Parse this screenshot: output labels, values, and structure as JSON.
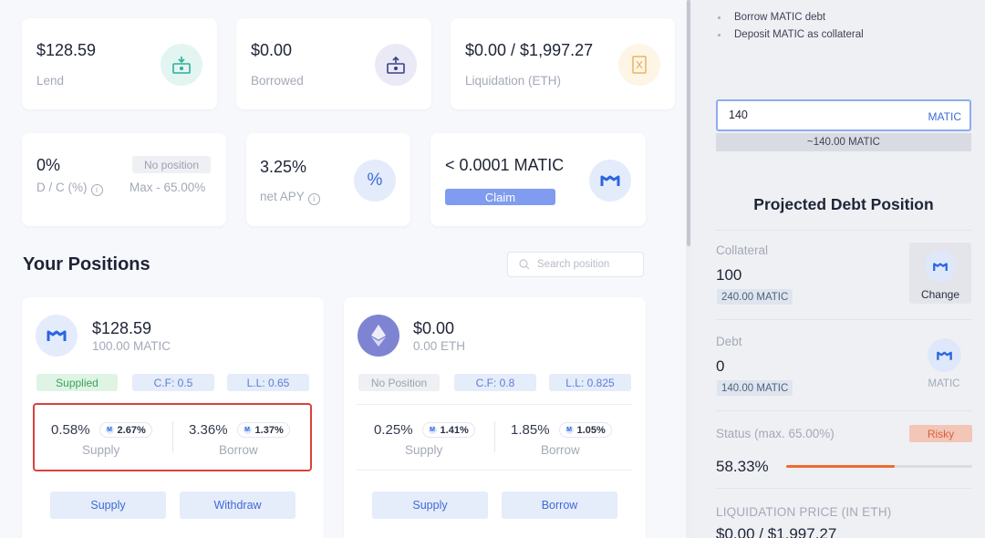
{
  "stats": {
    "lend": {
      "value": "$128.59",
      "label": "Lend"
    },
    "borrowed": {
      "value": "$0.00",
      "label": "Borrowed"
    },
    "liquidation": {
      "value": "$0.00 / $1,997.27",
      "label": "Liquidation (ETH)"
    },
    "dc": {
      "value": "0%",
      "label": "D / C (%)",
      "badge": "No position",
      "max": "Max - 65.00%"
    },
    "apy": {
      "value": "3.25%",
      "label": "net APY"
    },
    "reward": {
      "value": "< 0.0001 MATIC",
      "claim_label": "Claim"
    }
  },
  "positions": {
    "title": "Your Positions",
    "search_placeholder": "Search position",
    "cards": [
      {
        "value": "$128.59",
        "amount": "100.00 MATIC",
        "status": "Supplied",
        "cf": "C.F: 0.5",
        "ll": "L.L: 0.65",
        "supply_rate": "0.58%",
        "supply_bonus": "2.67%",
        "supply_label": "Supply",
        "borrow_rate": "3.36%",
        "borrow_bonus": "1.37%",
        "borrow_label": "Borrow",
        "btn1": "Supply",
        "btn2": "Withdraw"
      },
      {
        "value": "$0.00",
        "amount": "0.00 ETH",
        "status": "No Position",
        "cf": "C.F: 0.8",
        "ll": "L.L: 0.825",
        "supply_rate": "0.25%",
        "supply_bonus": "1.41%",
        "supply_label": "Supply",
        "borrow_rate": "1.85%",
        "borrow_bonus": "1.05%",
        "borrow_label": "Borrow",
        "btn1": "Supply",
        "btn2": "Borrow"
      }
    ]
  },
  "side": {
    "bullets": [
      "Borrow MATIC debt",
      "Deposit MATIC as collateral"
    ],
    "input_value": "140",
    "input_unit": "MATIC",
    "input_hint": "~140.00 MATIC",
    "projected_title": "Projected Debt Position",
    "collateral": {
      "label": "Collateral",
      "value": "100",
      "pill": "240.00 MATIC",
      "action": "Change"
    },
    "debt": {
      "label": "Debt",
      "value": "0",
      "pill": "140.00 MATIC",
      "asset": "MATIC"
    },
    "status": {
      "label": "Status (max. 65.00%)",
      "badge": "Risky",
      "value": "58.33%",
      "progress": 0.5833
    },
    "liq_label": "LIQUIDATION PRICE (IN ETH)",
    "liq_value": "$0.00 / $1,997.27"
  },
  "colors": {
    "accent": "#3e6bd8",
    "highlight": "#d9413d",
    "risky": "#f3c6b7",
    "progress": "#ee6a2f"
  }
}
